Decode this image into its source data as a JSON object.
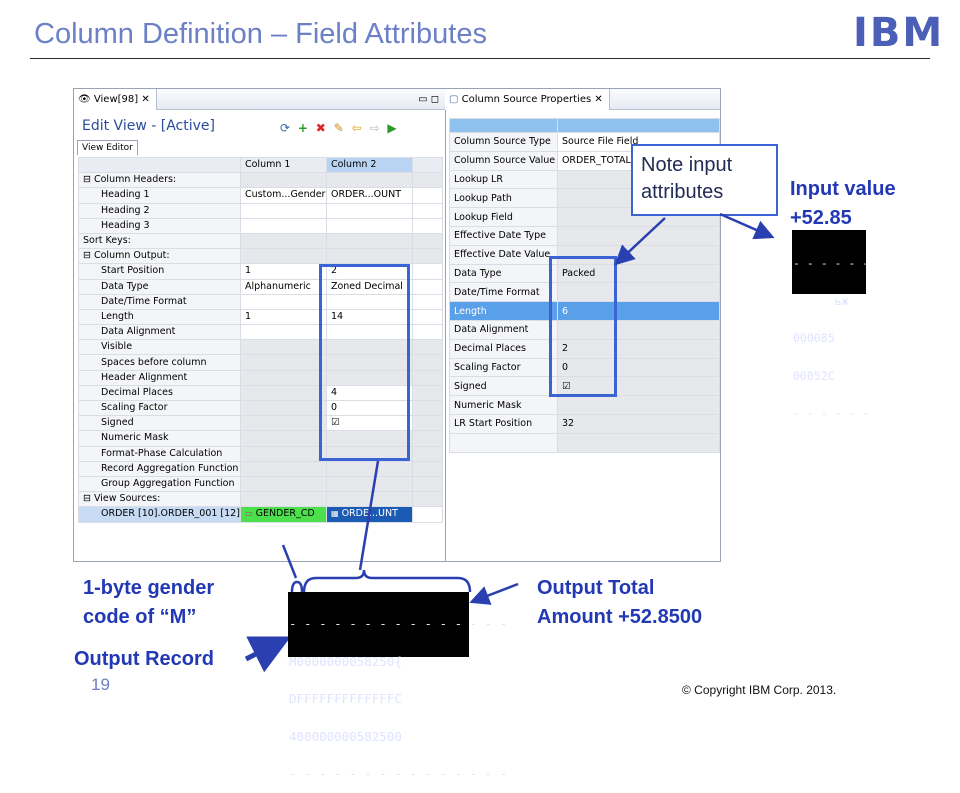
{
  "slide": {
    "title": "Column Definition – Field Attributes",
    "logo": "IBM",
    "page_number": "19",
    "copyright": "© Copyright  IBM Corp. 2013."
  },
  "left_pane": {
    "tab_label": "View[98]",
    "editor_title": "Edit View - [Active]",
    "editor_tab": "View Editor",
    "col_headers": [
      "Column 1",
      "Column 2"
    ],
    "rows": [
      {
        "label": "⊟  Column Headers:",
        "c1": "",
        "c2": ""
      },
      {
        "label": "Heading 1",
        "c1": "Custom...Gender",
        "c2": "ORDER...OUNT"
      },
      {
        "label": "Heading 2",
        "c1": "",
        "c2": ""
      },
      {
        "label": "Heading 3",
        "c1": "",
        "c2": ""
      },
      {
        "label": "Sort Keys:",
        "c1": "",
        "c2": ""
      },
      {
        "label": "⊟  Column Output:",
        "c1": "",
        "c2": ""
      },
      {
        "label": "Start Position",
        "c1": "1",
        "c2": "2"
      },
      {
        "label": "Data Type",
        "c1": "Alphanumeric",
        "c2": "Zoned Decimal"
      },
      {
        "label": "Date/Time Format",
        "c1": "",
        "c2": ""
      },
      {
        "label": "Length",
        "c1": "1",
        "c2": "14"
      },
      {
        "label": "Data Alignment",
        "c1": "",
        "c2": ""
      },
      {
        "label": "Visible",
        "c1": "",
        "c2": ""
      },
      {
        "label": "Spaces before column",
        "c1": "",
        "c2": ""
      },
      {
        "label": "Header Alignment",
        "c1": "",
        "c2": ""
      },
      {
        "label": "Decimal Places",
        "c1": "",
        "c2": "4"
      },
      {
        "label": "Scaling Factor",
        "c1": "",
        "c2": "0"
      },
      {
        "label": "Signed",
        "c1": "",
        "c2": "☑"
      },
      {
        "label": "Numeric Mask",
        "c1": "",
        "c2": ""
      },
      {
        "label": "Format-Phase Calculation",
        "c1": "",
        "c2": ""
      },
      {
        "label": "Record Aggregation Function",
        "c1": "",
        "c2": ""
      },
      {
        "label": "Group Aggregation Function",
        "c1": "",
        "c2": ""
      },
      {
        "label": "⊟  View Sources:",
        "c1": "",
        "c2": ""
      },
      {
        "label": "ORDER [10].ORDER_001 [12]",
        "c1": "GENDER_CD",
        "c2": "ORDE...UNT"
      }
    ]
  },
  "right_pane": {
    "tab_label": "Column Source Properties",
    "rows": [
      {
        "k": "Column Source Type",
        "v": "Source File Field"
      },
      {
        "k": "Column Source Value",
        "v": "ORDER_TOTAL_AMOUNT"
      },
      {
        "k": "Lookup LR",
        "v": ""
      },
      {
        "k": "Lookup Path",
        "v": ""
      },
      {
        "k": "Lookup Field",
        "v": ""
      },
      {
        "k": "Effective Date Type",
        "v": ""
      },
      {
        "k": "Effective Date Value",
        "v": ""
      },
      {
        "k": "Data Type",
        "v": "Packed"
      },
      {
        "k": "Date/Time Format",
        "v": ""
      },
      {
        "k": "Length",
        "v": "6"
      },
      {
        "k": "Data Alignment",
        "v": ""
      },
      {
        "k": "Decimal Places",
        "v": "2"
      },
      {
        "k": "Scaling Factor",
        "v": "0"
      },
      {
        "k": "Signed",
        "v": "☑"
      },
      {
        "k": "Numeric Mask",
        "v": ""
      },
      {
        "k": "LR Start Position",
        "v": "32"
      }
    ]
  },
  "annotations": {
    "note": [
      "Note input",
      "attributes"
    ],
    "input_value": [
      "Input value",
      "+52.85"
    ],
    "gender_label": [
      "1-byte gender",
      "code of “M”"
    ],
    "output_total": [
      "Output Total",
      "Amount +52.8500"
    ],
    "output_record": "Output Record"
  },
  "hex_input": [
    "- - - - - -",
    "      ьж",
    "000085",
    "00052C",
    "- - - - - -"
  ],
  "hex_output": [
    "- - - - - - - - - - - - - - -",
    "M0000000058250{",
    "DFFFFFFFFFFFFFC",
    "400000000582500",
    "- - - - - - - - - - - - - - -"
  ]
}
